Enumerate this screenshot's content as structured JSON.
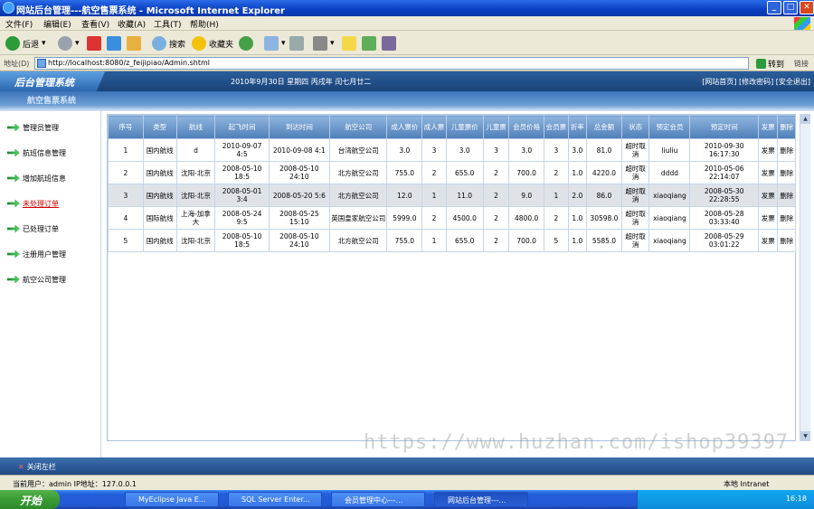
{
  "window": {
    "title": "网站后台管理---航空售票系统 - Microsoft Internet Explorer"
  },
  "menubar": [
    "文件(F)",
    "编辑(E)",
    "查看(V)",
    "收藏(A)",
    "工具(T)",
    "帮助(H)"
  ],
  "toolbar": {
    "back": "后退",
    "search": "搜索",
    "favorites": "收藏夹"
  },
  "address": {
    "label": "地址(D)",
    "url": "http://localhost:8080/z_feijipiao/Admin.shtml",
    "go": "转到",
    "links": "链接"
  },
  "banner": {
    "logo": "后台管理系统",
    "date": "2010年9月30日 星期四 丙戌年 闰七月廿二",
    "links": "[网站首页] [修改密码] [安全退出]",
    "subtitle": "航空售票系统"
  },
  "sidebar": [
    {
      "label": "管理员管理"
    },
    {
      "label": "航班信息管理"
    },
    {
      "label": "增加航班信息"
    },
    {
      "label": "未处理订单"
    },
    {
      "label": "已处理订单"
    },
    {
      "label": "注册用户管理"
    },
    {
      "label": "航空公司管理"
    }
  ],
  "table": {
    "headers": [
      "序号",
      "类型",
      "航线",
      "起飞时间",
      "到达时间",
      "航空公司",
      "成人票价",
      "成人票",
      "儿童票价",
      "儿童票",
      "会员价格",
      "会员票",
      "折率",
      "总金额",
      "状态",
      "预定会员",
      "预定时间",
      "发票",
      "删除"
    ],
    "rows": [
      [
        "1",
        "国内航线",
        "d",
        "2010-09-07 4:5",
        "2010-09-08 4:1",
        "台湾航空公司",
        "3.0",
        "3",
        "3.0",
        "3",
        "3.0",
        "3",
        "3.0",
        "81.0",
        "超时取消",
        "liuliu",
        "2010-09-30 16:17:30",
        "发票",
        "删除"
      ],
      [
        "2",
        "国内航线",
        "沈阳-北京",
        "2008-05-10 18:5",
        "2008-05-10 24:10",
        "北方航空公司",
        "755.0",
        "2",
        "655.0",
        "2",
        "700.0",
        "2",
        "1.0",
        "4220.0",
        "超时取消",
        "dddd",
        "2010-05-06 22:14:07",
        "发票",
        "删除"
      ],
      [
        "3",
        "国内航线",
        "沈阳-北京",
        "2008-05-01 3:4",
        "2008-05-20 5:6",
        "北方航空公司",
        "12.0",
        "1",
        "11.0",
        "2",
        "9.0",
        "1",
        "2.0",
        "86.0",
        "超时取消",
        "xiaoqiang",
        "2008-05-30 22:28:55",
        "发票",
        "删除"
      ],
      [
        "4",
        "国际航线",
        "上海-加拿大",
        "2008-05-24 9:5",
        "2008-05-25 15:10",
        "英国皇家航空公司",
        "5999.0",
        "2",
        "4500.0",
        "2",
        "4800.0",
        "2",
        "1.0",
        "30598.0",
        "超时取消",
        "xiaoqiang",
        "2008-05-28 03:33:40",
        "发票",
        "删除"
      ],
      [
        "5",
        "国内航线",
        "沈阳-北京",
        "2008-05-10 18:5",
        "2008-05-10 24:10",
        "北方航空公司",
        "755.0",
        "1",
        "655.0",
        "2",
        "700.0",
        "5",
        "1.0",
        "5585.0",
        "超时取消",
        "xiaoqiang",
        "2008-05-29 03:01:22",
        "发票",
        "删除"
      ]
    ]
  },
  "bottombar": {
    "close_label": "关闭左栏"
  },
  "watermark": "https://www.huzhan.com/ishop39397",
  "statusbar": {
    "user": "当前用户：admin  IP地址：127.0.0.1",
    "zone": "本地 Intranet"
  },
  "taskbar": {
    "start": "开始",
    "tasks": [
      "MyEclipse Java E...",
      "SQL Server Enter...",
      "会员管理中心---...",
      "网站后台管理---..."
    ],
    "clock": "16:18"
  }
}
